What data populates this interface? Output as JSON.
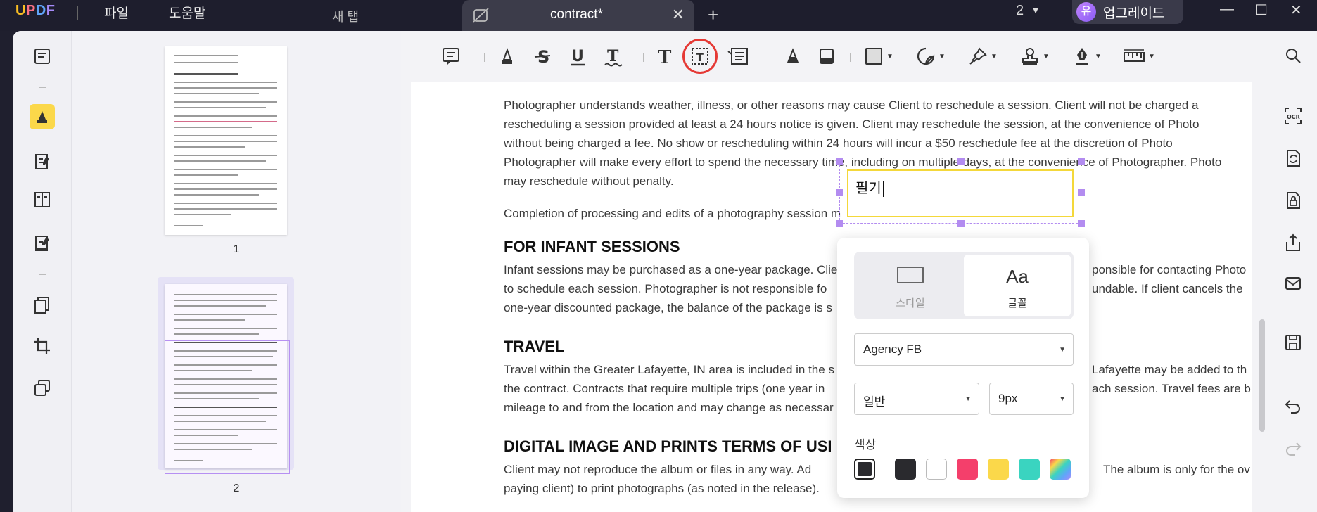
{
  "app": {
    "logo": "UPDF"
  },
  "menu": {
    "file": "파일",
    "help": "도움말"
  },
  "tabs": {
    "new_tab": "새 탭",
    "active_title": "contract*"
  },
  "window": {
    "count": "2",
    "upgrade_avatar": "유",
    "upgrade_label": "업그레이드"
  },
  "thumbnails": [
    {
      "label": "1"
    },
    {
      "label": "2"
    }
  ],
  "document": {
    "para1": [
      "Photographer understands weather, illness, or other reasons may cause Client to reschedule a session. Client will not be charged a",
      "rescheduling a session provided at least a 24 hours notice is given. Client may reschedule the session, at the convenience of Photo",
      "without being charged a fee. No show or rescheduling within 24 hours will incur a $50 reschedule fee at the discretion of Photo",
      "Photographer will make every effort to spend the necessary time, including on multiple days, at the convenience of Photographer. Photo",
      "may reschedule without penalty."
    ],
    "para2": "Completion of processing and edits of a photography session m",
    "h_infant": "FOR INFANT SESSIONS",
    "infant": [
      "Infant sessions may be purchased as a one-year package. Clie",
      "to schedule each session. Photographer is not responsible fo",
      "one-year discounted package, the balance of the package is s"
    ],
    "infant_right": [
      "ponsible for contacting Photo",
      "undable. If client cancels the",
      ""
    ],
    "h_travel": "TRAVEL",
    "travel": [
      "Travel within the Greater Lafayette, IN area is included in the s",
      "the contract. Contracts that require multiple trips (one year in",
      "mileage to and from the location and may change as necessar"
    ],
    "travel_right": [
      "Lafayette may be added to th",
      "ach session. Travel fees are b",
      ""
    ],
    "h_digital": "DIGITAL IMAGE AND PRINTS TERMS OF USI",
    "digital": [
      "Client may not reproduce the album or files in any way. Ad",
      "paying client) to print photographs (as noted in the release)."
    ],
    "digital_right": [
      "The album is only for the ov",
      ""
    ]
  },
  "textbox": {
    "typed": "필기"
  },
  "popover": {
    "tab_style": "스타일",
    "tab_font": "글꼴",
    "font_family": "Agency FB",
    "font_weight": "일반",
    "font_size": "9px",
    "color_title": "색상",
    "colors": [
      "#2a2a2e",
      "#2a2a2e",
      "#ffffff",
      "#f43f6b",
      "#fbd84a",
      "#3ad4c0",
      "gradient"
    ]
  },
  "colors": {
    "accent": "#8b5cf6",
    "highlight": "#e53935",
    "box_border": "#f4d83a"
  }
}
